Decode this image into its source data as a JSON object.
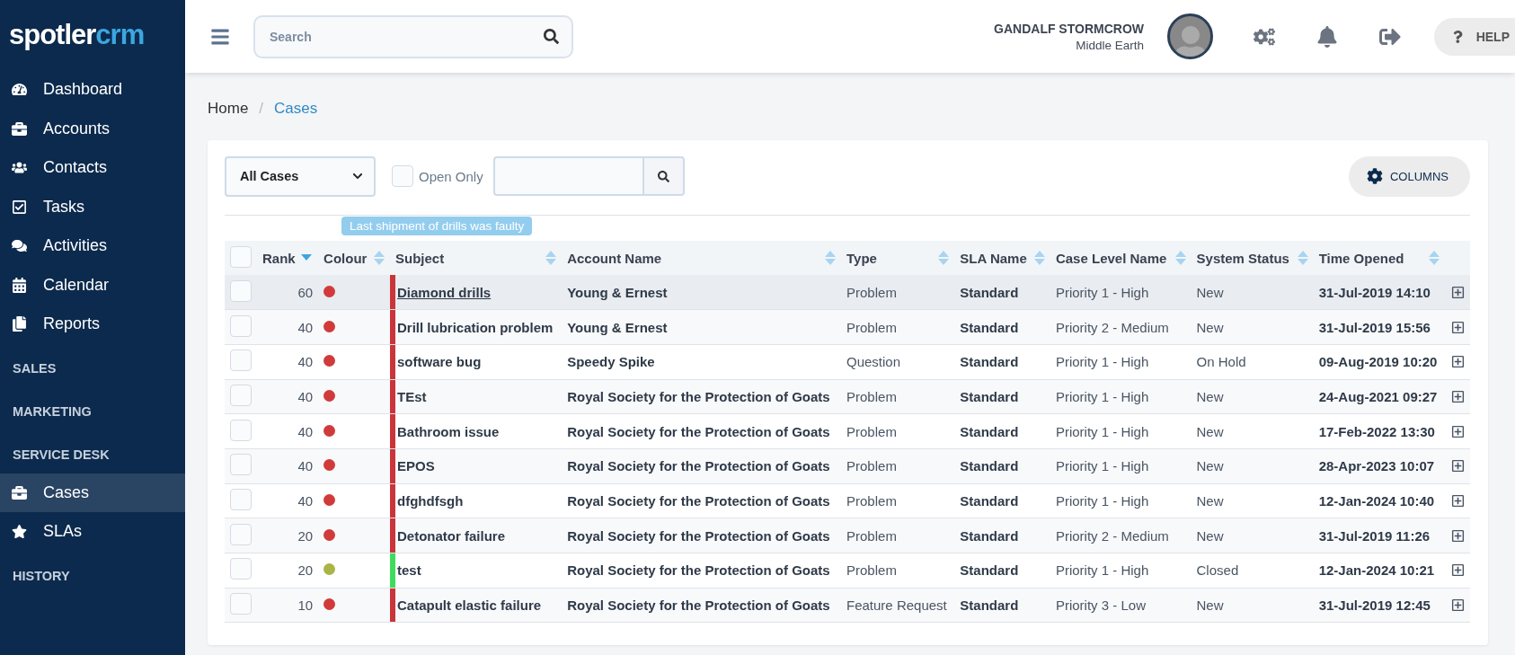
{
  "brand": {
    "part_1": "spotler",
    "part_2": "crm"
  },
  "search": {
    "placeholder": "Search"
  },
  "user": {
    "name": "GANDALF STORMCROW",
    "location": "Middle Earth"
  },
  "help": {
    "label": "HELP"
  },
  "sidebar": {
    "items": [
      {
        "kind": "link",
        "label": "Dashboard",
        "selected": false
      },
      {
        "kind": "link",
        "label": "Accounts",
        "selected": false
      },
      {
        "kind": "link",
        "label": "Contacts",
        "selected": false
      },
      {
        "kind": "link",
        "label": "Tasks",
        "selected": false
      },
      {
        "kind": "link",
        "label": "Activities",
        "selected": false
      },
      {
        "kind": "link",
        "label": "Calendar",
        "selected": false
      },
      {
        "kind": "link",
        "label": "Reports",
        "selected": false
      },
      {
        "kind": "section",
        "label": "SALES"
      },
      {
        "kind": "section",
        "label": "MARKETING"
      },
      {
        "kind": "section",
        "label": "SERVICE DESK"
      },
      {
        "kind": "link",
        "label": "Cases",
        "selected": true
      },
      {
        "kind": "link",
        "label": "SLAs",
        "selected": false
      },
      {
        "kind": "section",
        "label": "HISTORY"
      }
    ]
  },
  "breadcrumb": {
    "separator": "/",
    "items": [
      {
        "label": "Home",
        "current": false
      },
      {
        "label": "Cases",
        "current": true
      }
    ]
  },
  "filters": {
    "view": "All Cases",
    "open_only": {
      "label": "Open Only",
      "checked": false
    },
    "columns_button": "COLUMNS"
  },
  "tooltip": "Last shipment of drills was faulty",
  "table": {
    "select_all": {
      "checked": false
    },
    "columns": [
      {
        "label": "Rank",
        "sorted": true
      },
      {
        "label": "Colour",
        "sorted": false
      },
      {
        "label": "Subject",
        "sorted": false
      },
      {
        "label": "Account Name",
        "sorted": false
      },
      {
        "label": "Type",
        "sorted": false
      },
      {
        "label": "SLA Name",
        "sorted": false
      },
      {
        "label": "Case Level Name",
        "sorted": false
      },
      {
        "label": "System Status",
        "sorted": false
      },
      {
        "label": "Time Opened",
        "sorted": false
      }
    ],
    "rows": [
      {
        "checked": false,
        "hovered": true,
        "rank": "60",
        "color": "#d13a3a",
        "stripe": {
          "color": "#c9353a"
        },
        "subject": "Diamond drills",
        "account": "Young & Ernest",
        "type": "Problem",
        "sla": "Standard",
        "level": "Priority 1 - High",
        "status": "New",
        "opened": "31-Jul-2019 14:10"
      },
      {
        "checked": false,
        "hovered": false,
        "rank": "40",
        "color": "#d13a3a",
        "stripe": {
          "color": "#c9353a"
        },
        "subject": "Drill lubrication problem",
        "account": "Young & Ernest",
        "type": "Problem",
        "sla": "Standard",
        "level": "Priority 2 - Medium",
        "status": "New",
        "opened": "31-Jul-2019 15:56"
      },
      {
        "checked": false,
        "hovered": false,
        "rank": "40",
        "color": "#d13a3a",
        "stripe": {
          "color": "#c9353a"
        },
        "subject": "software bug",
        "account": "Speedy Spike",
        "type": "Question",
        "sla": "Standard",
        "level": "Priority 1 - High",
        "status": "On Hold",
        "opened": "09-Aug-2019 10:20"
      },
      {
        "checked": false,
        "hovered": false,
        "rank": "40",
        "color": "#d13a3a",
        "stripe": {
          "color": "#c9353a"
        },
        "subject": "TEst",
        "account": "Royal Society for the Protection of Goats",
        "type": "Problem",
        "sla": "Standard",
        "level": "Priority 1 - High",
        "status": "New",
        "opened": "24-Aug-2021 09:27"
      },
      {
        "checked": false,
        "hovered": false,
        "rank": "40",
        "color": "#d13a3a",
        "stripe": {
          "color": "#c9353a"
        },
        "subject": "Bathroom issue",
        "account": "Royal Society for the Protection of Goats",
        "type": "Problem",
        "sla": "Standard",
        "level": "Priority 1 - High",
        "status": "New",
        "opened": "17-Feb-2022 13:30"
      },
      {
        "checked": false,
        "hovered": false,
        "rank": "40",
        "color": "#d13a3a",
        "stripe": {
          "color": "#c9353a"
        },
        "subject": "EPOS",
        "account": "Royal Society for the Protection of Goats",
        "type": "Problem",
        "sla": "Standard",
        "level": "Priority 1 - High",
        "status": "New",
        "opened": "28-Apr-2023 10:07"
      },
      {
        "checked": false,
        "hovered": false,
        "rank": "40",
        "color": "#d13a3a",
        "stripe": {
          "color": "#c9353a"
        },
        "subject": "dfghdfsgh",
        "account": "Royal Society for the Protection of Goats",
        "type": "Problem",
        "sla": "Standard",
        "level": "Priority 1 - High",
        "status": "New",
        "opened": "12-Jan-2024 10:40"
      },
      {
        "checked": false,
        "hovered": false,
        "rank": "20",
        "color": "#d13a3a",
        "stripe": {
          "color": "#c9353a"
        },
        "subject": "Detonator failure",
        "account": "Royal Society for the Protection of Goats",
        "type": "Problem",
        "sla": "Standard",
        "level": "Priority 2 - Medium",
        "status": "New",
        "opened": "31-Jul-2019 11:26"
      },
      {
        "checked": false,
        "hovered": false,
        "rank": "20",
        "color": "#a9b546",
        "stripe": {
          "color": "#3ddc5c"
        },
        "subject": "test",
        "account": "Royal Society for the Protection of Goats",
        "type": "Problem",
        "sla": "Standard",
        "level": "Priority 1 - High",
        "status": "Closed",
        "opened": "12-Jan-2024 10:21"
      },
      {
        "checked": false,
        "hovered": false,
        "rank": "10",
        "color": "#d13a3a",
        "stripe": {
          "color": "#c9353a"
        },
        "subject": "Catapult elastic failure",
        "account": "Royal Society for the Protection of Goats",
        "type": "Feature Request",
        "sla": "Standard",
        "level": "Priority 3 - Low",
        "status": "New",
        "opened": "31-Jul-2019 12:45"
      }
    ]
  }
}
